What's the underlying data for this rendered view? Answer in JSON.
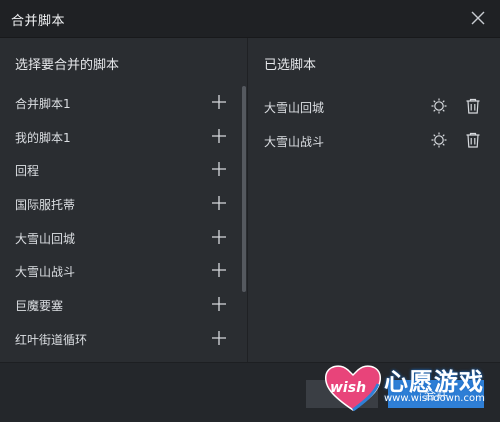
{
  "window": {
    "title": "合并脚本"
  },
  "left_panel": {
    "heading": "选择要合并的脚本",
    "items": [
      {
        "label": "合并脚本1"
      },
      {
        "label": "我的脚本1"
      },
      {
        "label": "回程"
      },
      {
        "label": "国际服托蒂"
      },
      {
        "label": "大雪山回城"
      },
      {
        "label": "大雪山战斗"
      },
      {
        "label": "巨魔要塞"
      },
      {
        "label": "红叶街道循环"
      }
    ]
  },
  "right_panel": {
    "heading": "已选脚本",
    "items": [
      {
        "label": "大雪山回城"
      },
      {
        "label": "大雪山战斗"
      }
    ]
  },
  "footer": {
    "merge_label": "合并"
  },
  "watermark": {
    "brand": "心愿游戏",
    "logo_text": "wish",
    "url": "www.wishdown.com"
  },
  "colors": {
    "accent": "#2f7fd6",
    "background": "#2a2d31",
    "titlebar": "#1f2124",
    "watermark_pink": "#e8447a"
  },
  "icons": {
    "close": "close-icon",
    "add": "plus-icon",
    "settings": "gear-icon",
    "delete": "trash-icon"
  }
}
